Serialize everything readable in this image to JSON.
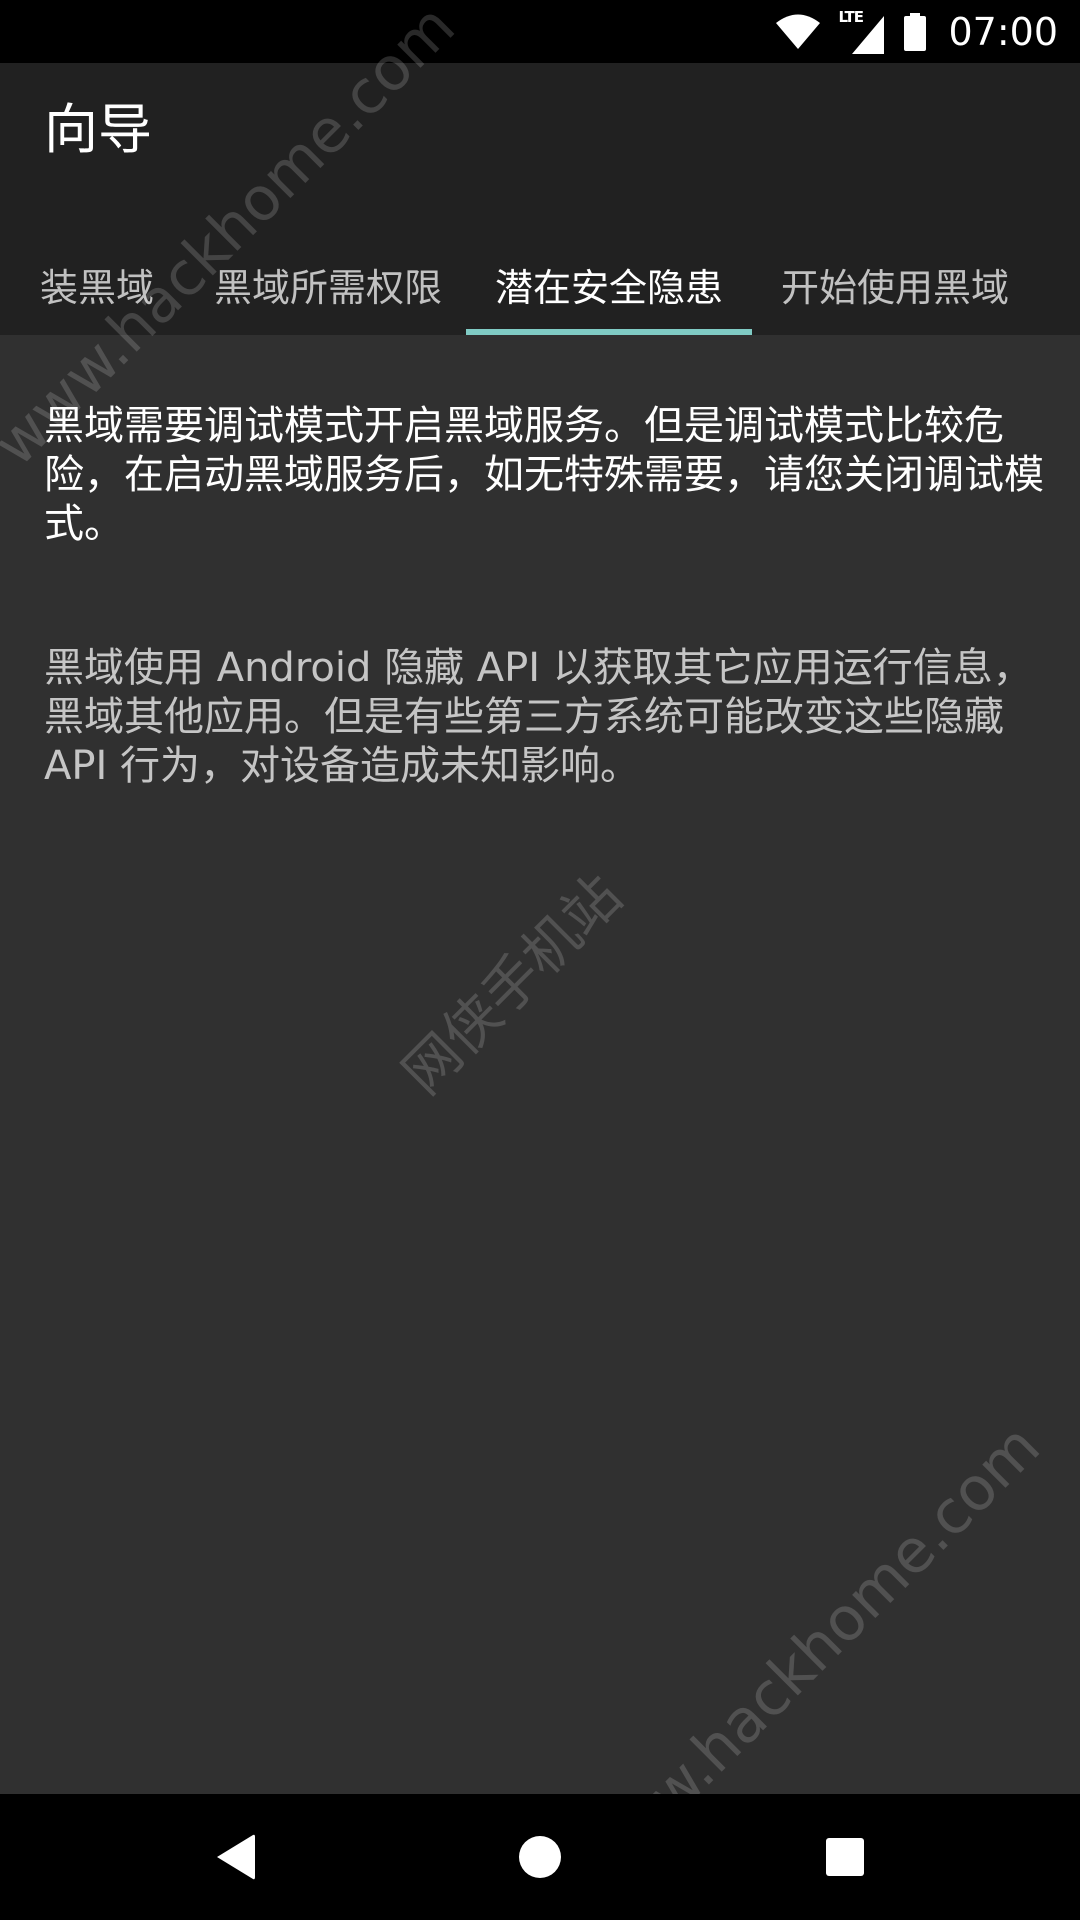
{
  "status_bar": {
    "time": "07:00",
    "network_label": "LTE",
    "icons": [
      "wifi-icon",
      "lte-signal-icon",
      "battery-icon"
    ]
  },
  "app_bar": {
    "title": "向导"
  },
  "tabs": [
    {
      "label": "装黑域",
      "selected": false
    },
    {
      "label": "黑域所需权限",
      "selected": false
    },
    {
      "label": "潜在安全隐患",
      "selected": true
    },
    {
      "label": "开始使用黑域",
      "selected": false
    }
  ],
  "content": {
    "paragraph_1": "黑域需要调试模式开启黑域服务。但是调试模式比较危险，在启动黑域服务后，如无特殊需要，请您关闭调试模式。",
    "paragraph_2": "黑域使用 Android 隐藏 API 以获取其它应用运行信息，黑域其他应用。但是有些第三方系统可能改变这些隐藏 API 行为，对设备造成未知影响。"
  },
  "watermarks": {
    "site_url": "www.hackhome.com",
    "site_name": "网侠手机站"
  },
  "nav_bar": {
    "icons": [
      "back-icon",
      "home-icon",
      "recents-icon"
    ]
  },
  "colors": {
    "status_bar": "#000000",
    "app_bar": "#212121",
    "background": "#303030",
    "tab_indicator": "#80cbc4",
    "nav_bar": "#000000"
  }
}
